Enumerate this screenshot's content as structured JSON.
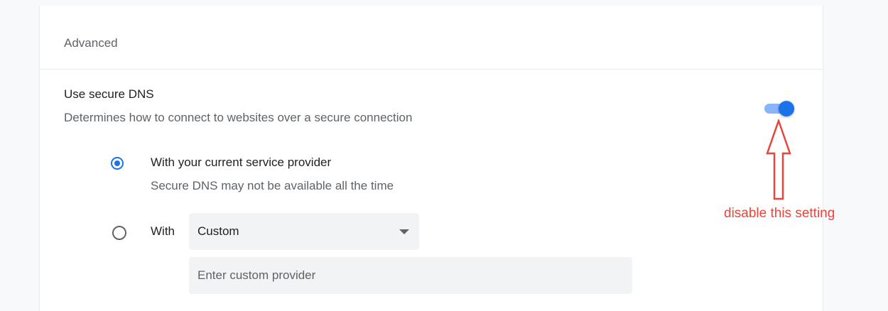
{
  "section": {
    "title": "Advanced"
  },
  "secure_dns": {
    "title": "Use secure DNS",
    "description": "Determines how to connect to websites over a secure connection",
    "toggle_on": true,
    "options": [
      {
        "label": "With your current service provider",
        "sublabel": "Secure DNS may not be available all the time",
        "selected": true
      },
      {
        "label": "With",
        "selected": false
      }
    ],
    "provider_select": {
      "value": "Custom"
    },
    "custom_provider": {
      "placeholder": "Enter custom provider",
      "value": ""
    }
  },
  "annotation": {
    "text": "disable this setting",
    "color": "#e8453c"
  },
  "colors": {
    "accent": "#1a73e8",
    "toggle_track": "#8ab4f8",
    "field_bg": "#f1f3f4"
  },
  "icons": {
    "toggle": "toggle-switch-icon",
    "dropdown": "chevron-down-icon",
    "arrow": "up-arrow-icon"
  }
}
